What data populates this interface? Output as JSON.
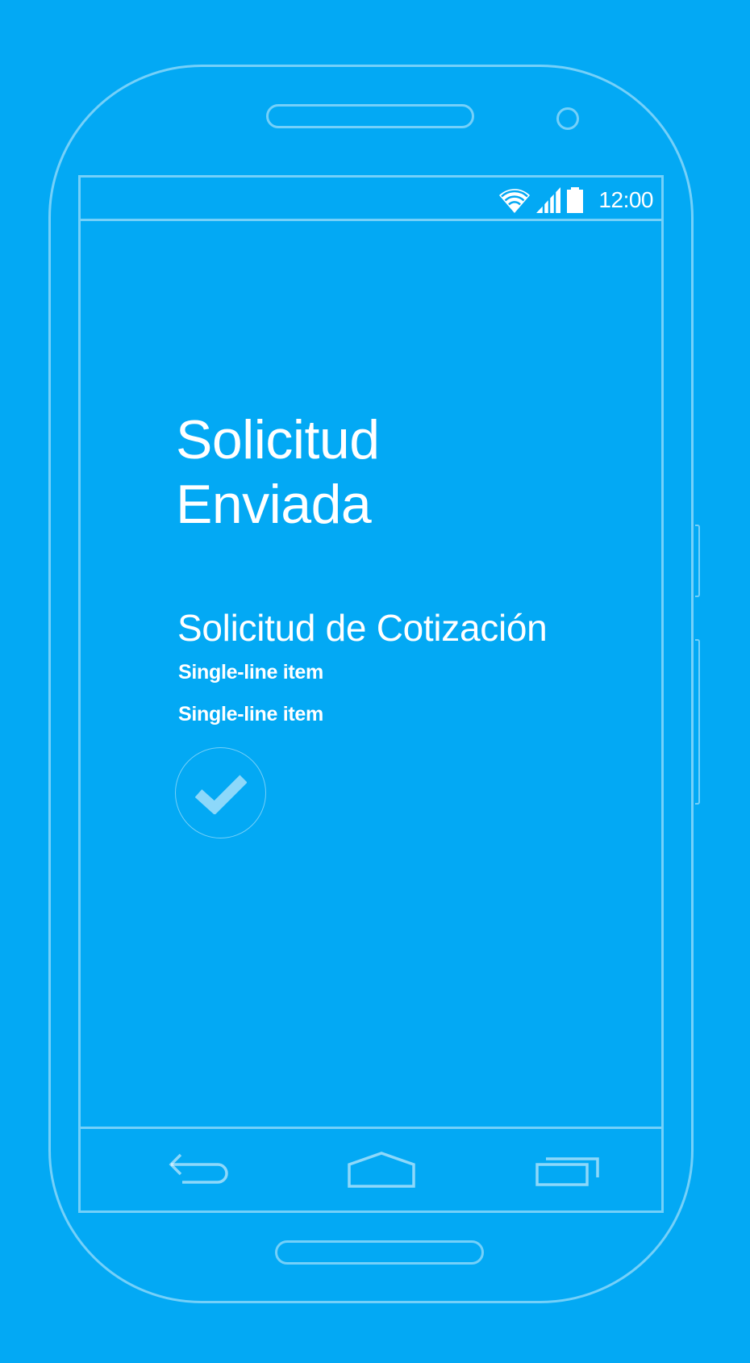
{
  "status_bar": {
    "time": "12:00",
    "icons": [
      "wifi-icon",
      "signal-icon",
      "battery-icon"
    ]
  },
  "main": {
    "title_line1": "Solicitud",
    "title_line2": "Enviada",
    "subtitle": "Solicitud de Cotización",
    "items": [
      {
        "label": "Single-line item"
      },
      {
        "label": "Single-line item"
      }
    ],
    "confirm_icon": "check-icon"
  },
  "nav_bar": {
    "buttons": [
      "back-icon",
      "home-icon",
      "recents-icon"
    ]
  },
  "colors": {
    "background": "#03a9f4",
    "text": "#ffffff",
    "outline": "#81d4fa"
  }
}
